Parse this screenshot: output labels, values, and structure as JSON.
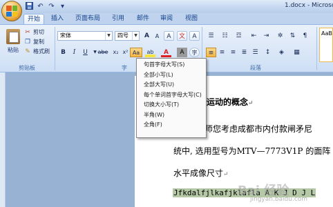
{
  "window": {
    "title": "1.docx - Microsof"
  },
  "quick_access": {
    "save_icon": "save-icon",
    "undo_symbol": "↶",
    "redo_symbol": "↷",
    "more_symbol": "▾"
  },
  "tabs": [
    "开始",
    "插入",
    "页面布局",
    "引用",
    "邮件",
    "审阅",
    "视图"
  ],
  "ribbon": {
    "clipboard": {
      "paste_label": "粘贴",
      "cut_label": "剪切",
      "copy_label": "复制",
      "format_painter_label": "格式刷",
      "group_label": "剪贴板"
    },
    "font": {
      "font_name": "宋体",
      "font_size": "四号",
      "grow_label": "A",
      "shrink_label": "A",
      "clear_label": "A",
      "phonetic_label": "文",
      "border_label": "A",
      "bold_label": "B",
      "italic_label": "I",
      "underline_label": "U",
      "strike_label": "abe",
      "subscript_label": "x₂",
      "superscript_label": "x²",
      "change_case_label": "Aa",
      "highlight_label": "ab",
      "font_color_label": "A",
      "shade_label": "A",
      "encircle_label": "字",
      "group_label": "字"
    },
    "paragraph": {
      "group_label": "段落"
    },
    "styles": {
      "preview": "AaB"
    }
  },
  "change_case_menu": {
    "items": [
      "句首字母大写(S)",
      "全部小写(L)",
      "全部大写(U)",
      "每个单词首字母大写(C)",
      "切换大小写(T)",
      "半角(W)",
      "全角(F)"
    ]
  },
  "document": {
    "heading": "运动的概念",
    "line1": "老师您考虑成都市内付款闸矛尼",
    "line2": "统中, 选用型号为MTV—7773V1P 的面阵",
    "line3": "水平成像尺寸",
    "selected_line": "Jfkdalfjlkafjklafla A K J D J L",
    "para_mark": "↵"
  },
  "watermark": {
    "text": "Bai 经验",
    "sub": "jingyan.baidu.com"
  },
  "colors": {
    "accent": "#15428b",
    "ribbon_bg": "#dbe7f7",
    "highlight": "#f4b545",
    "font_color_red": "#e02020",
    "selection": "#b5c9a6",
    "workspace": "#98b2d4"
  }
}
